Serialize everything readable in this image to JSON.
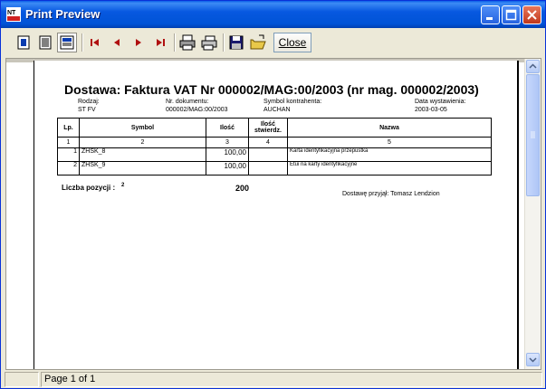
{
  "window": {
    "title": "Print Preview",
    "controls": {
      "minimize": "minimize-icon",
      "maximize": "maximize-icon",
      "close": "close-icon"
    }
  },
  "toolbar": {
    "tools": [
      "single-page-icon",
      "multi-page-icon",
      "fit-page-icon",
      "first-page-icon",
      "prev-page-icon",
      "next-page-icon",
      "last-page-icon",
      "print-icon",
      "print-setup-icon",
      "save-icon",
      "open-icon"
    ],
    "close_label": "Close"
  },
  "document": {
    "title": "Dostawa: Faktura VAT   Nr 000002/MAG:00/2003   (nr mag. 000002/2003)",
    "meta": {
      "rodzaj_label": "Rodzaj:",
      "rodzaj_value": "ST FV",
      "nr_label": "Nr. dokumentu:",
      "nr_value": "000002/MAG:00/2003",
      "kontrahent_label": "Symbol kontrahenta:",
      "kontrahent_value": "AUCHAN",
      "data_label": "Data wystawienia:",
      "data_value": "2003-03-05"
    },
    "table": {
      "headers": [
        "Lp.",
        "Symbol",
        "Ilość",
        "Ilość stwierdz.",
        "Nazwa"
      ],
      "header_numbers": [
        "1",
        "2",
        "3",
        "4",
        "5"
      ],
      "rows": [
        {
          "lp": "1",
          "symbol": "ZHSK_8",
          "ilosc": "100,00",
          "stwierdz": "",
          "nazwa": "Karta identyfikacyjna przepustka"
        },
        {
          "lp": "2",
          "symbol": "ZHSK_9",
          "ilosc": "100,00",
          "stwierdz": "",
          "nazwa": "Etui na karty identyfikacyjne"
        }
      ]
    },
    "footer": {
      "count_label": "Liczba pozycji :",
      "count_value": "2",
      "sum": "200",
      "received_by": "Dostawę przyjął:  Tomasz Lendzion"
    }
  },
  "status": {
    "page": "Page 1 of 1"
  }
}
